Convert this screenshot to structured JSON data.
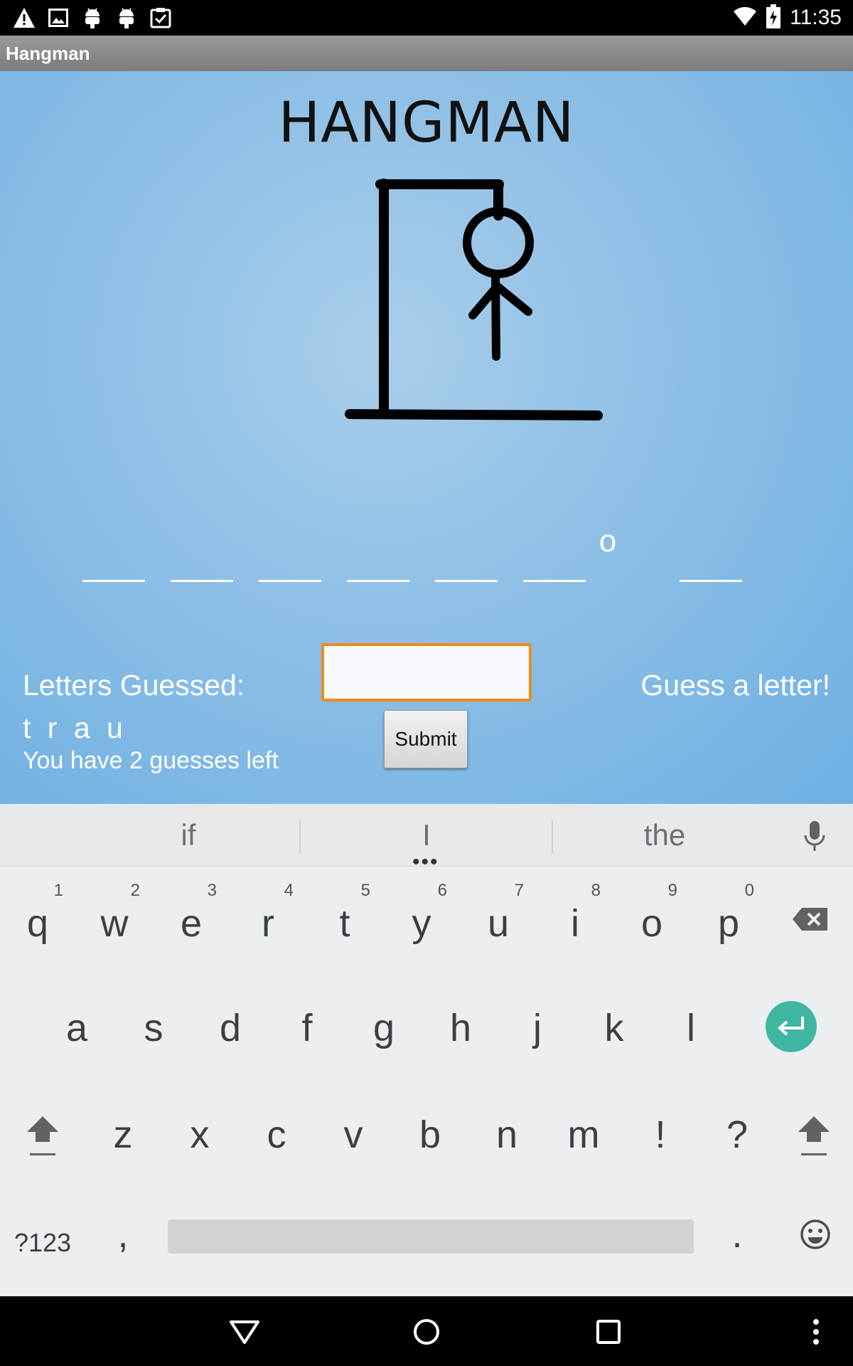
{
  "status_bar": {
    "time": "11:35",
    "icons": [
      "warning-icon",
      "image-icon",
      "android-icon",
      "android-icon",
      "clipboard-check-icon",
      "wifi-icon",
      "battery-charging-icon"
    ]
  },
  "app_bar": {
    "title": "Hangman"
  },
  "game": {
    "title": "HANGMAN",
    "word_slots": [
      "",
      "",
      "",
      "",
      "",
      "",
      "o",
      ""
    ],
    "letters_guessed_label": "Letters Guessed:",
    "letters_guessed": "t r a u",
    "guesses_left": "You have 2 guesses left",
    "prompt": "Guess a letter!",
    "input": {
      "value": "",
      "placeholder": ""
    },
    "submit_label": "Submit"
  },
  "keyboard": {
    "suggestions": [
      "if",
      "I",
      "the"
    ],
    "rows": [
      [
        {
          "key": "q",
          "hint": "1"
        },
        {
          "key": "w",
          "hint": "2"
        },
        {
          "key": "e",
          "hint": "3"
        },
        {
          "key": "r",
          "hint": "4"
        },
        {
          "key": "t",
          "hint": "5"
        },
        {
          "key": "y",
          "hint": "6"
        },
        {
          "key": "u",
          "hint": "7"
        },
        {
          "key": "i",
          "hint": "8"
        },
        {
          "key": "o",
          "hint": "9"
        },
        {
          "key": "p",
          "hint": "0"
        }
      ],
      [
        {
          "key": "a"
        },
        {
          "key": "s"
        },
        {
          "key": "d"
        },
        {
          "key": "f"
        },
        {
          "key": "g"
        },
        {
          "key": "h"
        },
        {
          "key": "j"
        },
        {
          "key": "k"
        },
        {
          "key": "l"
        }
      ],
      [
        {
          "key": "z"
        },
        {
          "key": "x"
        },
        {
          "key": "c"
        },
        {
          "key": "v"
        },
        {
          "key": "b"
        },
        {
          "key": "n"
        },
        {
          "key": "m"
        },
        {
          "key": "!"
        },
        {
          "key": "?"
        }
      ]
    ],
    "symbols_label": "?123",
    "comma": ",",
    "period": ".",
    "accent_color": "#3fb6a2"
  },
  "colors": {
    "background_blue": "#8dbfe6",
    "input_focus_border": "#f28a1a"
  }
}
